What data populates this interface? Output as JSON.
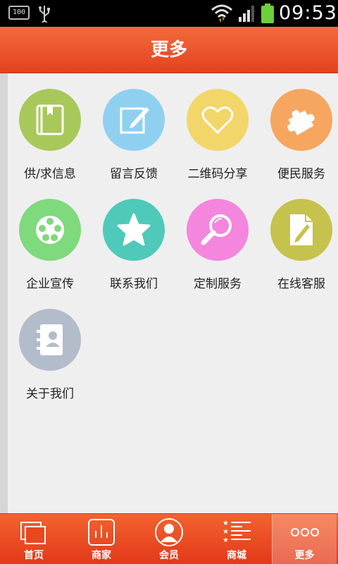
{
  "statusbar": {
    "battery_level": "100",
    "time": "09:53"
  },
  "header": {
    "title": "更多"
  },
  "tiles": [
    {
      "label": "供/求信息",
      "icon": "book-icon",
      "color": "#a8c85a"
    },
    {
      "label": "留言反馈",
      "icon": "edit-note-icon",
      "color": "#8fd0f0"
    },
    {
      "label": "二维码分享",
      "icon": "heart-icon",
      "color": "#f3d669"
    },
    {
      "label": "便民服务",
      "icon": "puzzle-icon",
      "color": "#f6a65f"
    },
    {
      "label": "企业宣传",
      "icon": "film-reel-icon",
      "color": "#7fd97d"
    },
    {
      "label": "联系我们",
      "icon": "star-icon",
      "color": "#4fc9b9"
    },
    {
      "label": "定制服务",
      "icon": "magnifier-icon",
      "color": "#f486dd"
    },
    {
      "label": "在线客服",
      "icon": "document-edit-icon",
      "color": "#c6c24e"
    },
    {
      "label": "关于我们",
      "icon": "contact-book-icon",
      "color": "#b3bccb"
    }
  ],
  "tabbar": {
    "items": [
      {
        "label": "首页",
        "icon": "home-pages-icon"
      },
      {
        "label": "商家",
        "icon": "bar-chart-icon"
      },
      {
        "label": "会员",
        "icon": "user-icon"
      },
      {
        "label": "商城",
        "icon": "star-list-icon"
      },
      {
        "label": "更多",
        "icon": "more-dots-icon",
        "active": true
      }
    ]
  }
}
